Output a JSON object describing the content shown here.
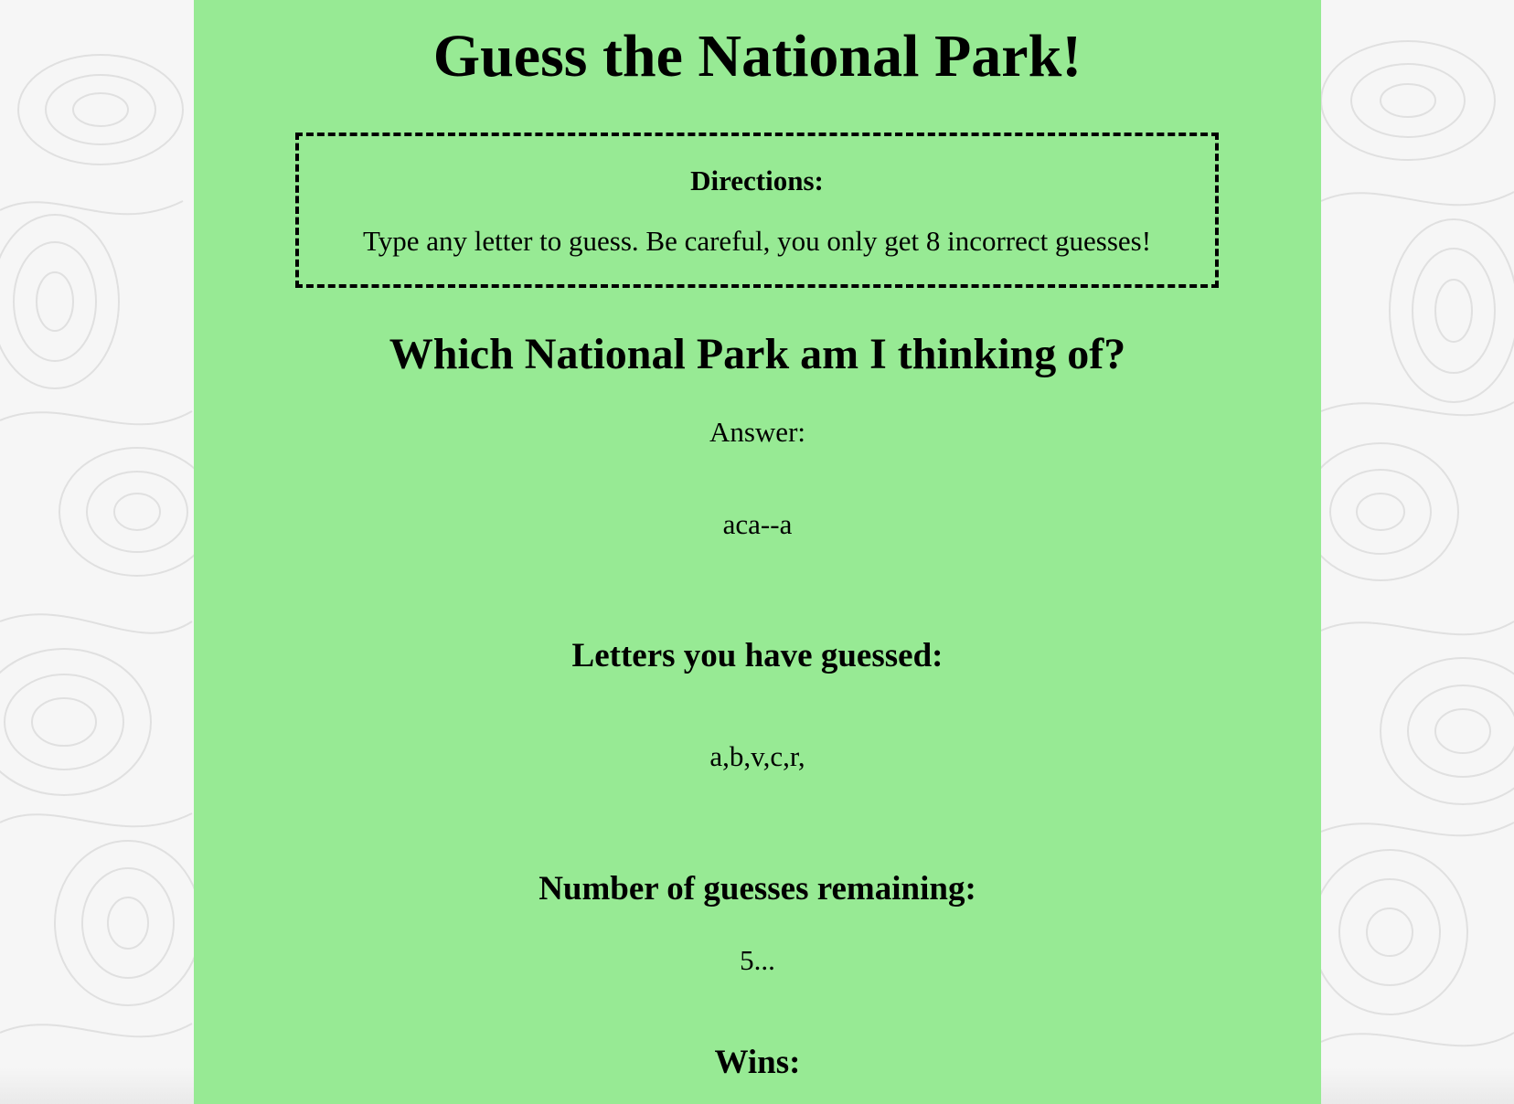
{
  "page": {
    "title": "Guess the National Park!"
  },
  "directions": {
    "heading": "Directions:",
    "text": "Type any letter to guess. Be careful, you only get 8 incorrect guesses!"
  },
  "question": "Which National Park am I thinking of?",
  "answer": {
    "label": "Answer:",
    "word": "aca--a"
  },
  "guessed": {
    "heading": "Letters you have guessed:",
    "letters": "a,b,v,c,r,"
  },
  "remaining": {
    "heading": "Number of guesses remaining:",
    "value": "5..."
  },
  "wins": {
    "heading": "Wins:"
  },
  "colors": {
    "panel_background": "#97ea94",
    "page_background": "#f6f6f6",
    "topo_lines": "#e2e2e2",
    "text": "#000000"
  }
}
